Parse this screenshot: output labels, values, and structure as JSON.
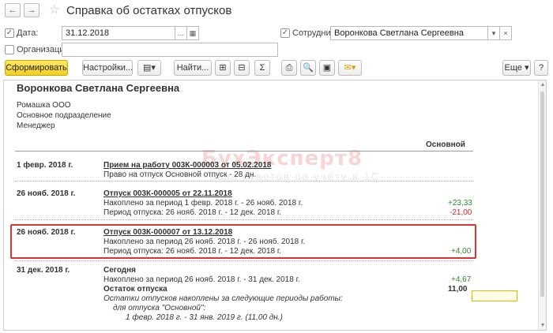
{
  "window": {
    "title": "Справка об остатках отпусков",
    "back": "←",
    "forward": "→",
    "star": "☆"
  },
  "filters": {
    "date_label": "Дата:",
    "date_value": "31.12.2018",
    "employee_label": "Сотрудник:",
    "employee_value": "Воронкова Светлана Сергеевна",
    "org_label": "Организация:",
    "org_value": "",
    "check": "✓"
  },
  "toolbar": {
    "generate": "Сформировать",
    "settings": "Настройки...",
    "find": "Найти...",
    "sum": "Σ",
    "more": "Еще",
    "help": "?"
  },
  "report": {
    "name": "Воронкова Светлана Сергеевна",
    "org": "Ромашка ООО",
    "department": "Основное подразделение",
    "position": "Менеджер",
    "column": "Основной",
    "watermark_main": "БухЭксперт8",
    "watermark_sub": "База ответов по учёту в 1С",
    "entries": [
      {
        "date": "1 февр. 2018 г.",
        "doc": "Прием на работу 003К-000003 от 05.02.2018",
        "line1": "Право на отпуск Основной отпуск - 28 дн.",
        "line1_val": "",
        "line2": "",
        "line2_val": ""
      },
      {
        "date": "26 нояб. 2018 г.",
        "doc": "Отпуск 003К-000005 от 22.11.2018",
        "line1": "Накоплено за период 1 февр. 2018 г. - 26 нояб. 2018 г.",
        "line1_val": "+23,33",
        "line2": "Период отпуска: 26 нояб. 2018 г. - 12 дек. 2018 г.",
        "line2_val": "-21,00"
      },
      {
        "date": "26 нояб. 2018 г.",
        "doc": "Отпуск 003К-000007 от 13.12.2018",
        "line1": "Накоплено за период 26 нояб. 2018 г. - 26 нояб. 2018 г.",
        "line1_val": "",
        "line2": "Период отпуска: 26 нояб. 2018 г. - 12 дек. 2018 г.",
        "line2_val": "+4,00"
      }
    ],
    "final": {
      "date": "31 дек. 2018 г.",
      "label": "Сегодня",
      "accrued": "Накоплено за период 26 нояб. 2018 г. - 31 дек. 2018 г.",
      "accrued_val": "+4,67",
      "balance_label": "Остаток отпуска",
      "balance_val": "11,00",
      "note1": "Остатки отпусков накоплены за следующие периоды работы:",
      "note2": "для отпуска \"Основной\":",
      "note3": "1 февр. 2018 г. - 31 янв. 2019 г. (11,00 дн.)"
    }
  }
}
